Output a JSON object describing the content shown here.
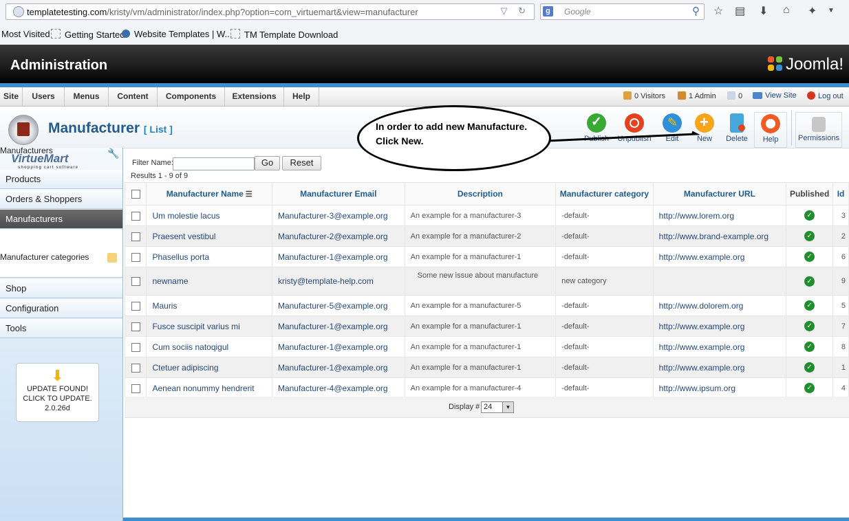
{
  "browser": {
    "url_host": "templatetesting.com",
    "url_path": "/kristy/vm/administrator/index.php?option=com_virtuemart&view=manufacturer",
    "search_placeholder": "Google",
    "bookmarks": [
      "Most Visited",
      "Getting Started",
      "Website Templates | W...",
      "TM Template Download"
    ]
  },
  "header": {
    "title": "Administration",
    "brand": "Joomla!"
  },
  "menu": {
    "items": [
      "Site",
      "Users",
      "Menus",
      "Content",
      "Components",
      "Extensions",
      "Help"
    ],
    "visitors": "0 Visitors",
    "admins": "1 Admin",
    "messages": "0",
    "view_site": "View Site",
    "logout": "Log out"
  },
  "page": {
    "title": "Manufacturer",
    "subtitle": "[ List ]"
  },
  "toolbar": {
    "publish": "Publish",
    "unpublish": "Unpublish",
    "edit": "Edit",
    "new": "New",
    "delete": "Delete",
    "help": "Help",
    "permissions": "Permissions"
  },
  "callout": {
    "text": "In order to add new Manufacture. Click New."
  },
  "sidebar": {
    "logo": "VirtueMart",
    "logo_tagline": "shopping cart software",
    "items": [
      "Products",
      "Orders & Shoppers",
      "Manufacturers"
    ],
    "sub_items": [
      "Manufacturers",
      "Manufacturer categories"
    ],
    "items2": [
      "Shop",
      "Configuration",
      "Tools"
    ],
    "update": {
      "line1": "UPDATE FOUND!",
      "line2": "CLICK TO UPDATE.",
      "version": "2.0.26d"
    }
  },
  "filter": {
    "label": "Filter Name:",
    "value": "",
    "go": "Go",
    "reset": "Reset",
    "results": "Results 1 - 9 of 9"
  },
  "table": {
    "headers": [
      "Manufacturer Name",
      "Manufacturer Email",
      "Description",
      "Manufacturer category",
      "Manufacturer URL",
      "Published",
      "Id"
    ],
    "rows": [
      {
        "name": "Um molestie lacus",
        "email": "Manufacturer-3@example.org",
        "desc": "An example for a manufacturer-3",
        "cat": "-default-",
        "url": "http://www.lorem.org",
        "id": "3"
      },
      {
        "name": "Praesent vestibul",
        "email": "Manufacturer-2@example.org",
        "desc": "An example for a manufacturer-2",
        "cat": "-default-",
        "url": "http://www.brand-example.org",
        "id": "2"
      },
      {
        "name": "Phasellus porta",
        "email": "Manufacturer-1@example.org",
        "desc": "An example for a manufacturer-1",
        "cat": "-default-",
        "url": "http://www.example.org",
        "id": "6"
      },
      {
        "name": "newname",
        "email": "kristy@template-help.com",
        "desc": "Some new issue about manufacture",
        "cat": "new category",
        "url": "",
        "id": "9"
      },
      {
        "name": "Mauris",
        "email": "Manufacturer-5@example.org",
        "desc": "An example for a manufacturer-5",
        "cat": "-default-",
        "url": "http://www.dolorem.org",
        "id": "5"
      },
      {
        "name": "Fusce suscipit varius mi",
        "email": "Manufacturer-1@example.org",
        "desc": "An example for a manufacturer-1",
        "cat": "-default-",
        "url": "http://www.example.org",
        "id": "7"
      },
      {
        "name": "Cum sociis natoqigul",
        "email": "Manufacturer-1@example.org",
        "desc": "An example for a manufacturer-1",
        "cat": "-default-",
        "url": "http://www.example.org",
        "id": "8"
      },
      {
        "name": "Ctetuer adipiscing",
        "email": "Manufacturer-1@example.org",
        "desc": "An example for a manufacturer-1",
        "cat": "-default-",
        "url": "http://www.example.org",
        "id": "1"
      },
      {
        "name": "Aenean nonummy hendrerit",
        "email": "Manufacturer-4@example.org",
        "desc": "An example for a manufacturer-4",
        "cat": "-default-",
        "url": "http://www.ipsum.org",
        "id": "4"
      }
    ]
  },
  "display": {
    "label": "Display #",
    "value": "24"
  },
  "colors": {
    "title_blue": "#1f5c8f",
    "link_blue": "#25487b",
    "published_green": "#1f8f2c"
  }
}
